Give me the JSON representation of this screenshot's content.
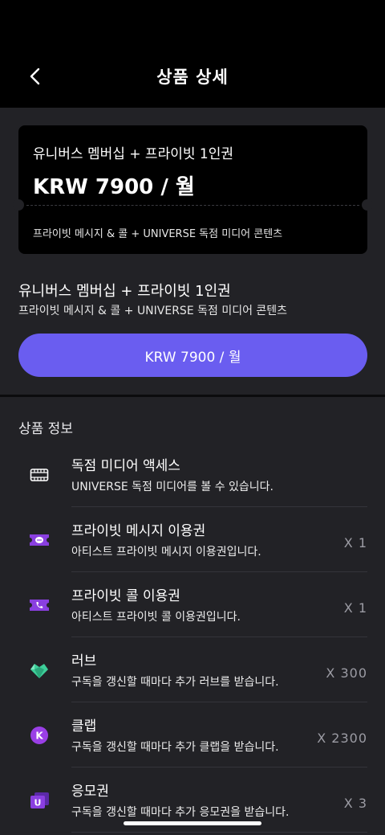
{
  "header": {
    "title": "상품 상세",
    "back_icon": "chevron-left-icon"
  },
  "ticket": {
    "title": "유니버스 멤버십 + 프라이빗 1인권",
    "price": "KRW 7900 / 월",
    "description": "프라이빗 메시지 & 콜 + UNIVERSE 독점 미디어 콘텐츠"
  },
  "plan": {
    "title": "유니버스 멤버십 + 프라이빗 1인권",
    "description": "프라이빗 메시지 & 콜 + UNIVERSE 독점 미디어 콘텐츠",
    "button_label": "KRW 7900 / 월"
  },
  "info": {
    "title": "상품 정보",
    "items": [
      {
        "icon": "film-icon",
        "name": "독점 미디어 액세스",
        "sub": "UNIVERSE 독점 미디어를 볼 수 있습니다.",
        "qty": ""
      },
      {
        "icon": "message-ticket-icon",
        "name": "프라이빗 메시지 이용권",
        "sub": "아티스트 프라이빗 메시지 이용권입니다.",
        "qty": "X 1"
      },
      {
        "icon": "call-ticket-icon",
        "name": "프라이빗 콜 이용권",
        "sub": "아티스트 프라이빗 콜 이용권입니다.",
        "qty": "X 1"
      },
      {
        "icon": "heart-gem-icon",
        "name": "러브",
        "sub": "구독을 갱신할 때마다 추가 러브를 받습니다.",
        "qty": "X 300"
      },
      {
        "icon": "k-coin-icon",
        "name": "클랩",
        "sub": "구독을 갱신할 때마다 추가 클랩을 받습니다.",
        "qty": "X 2300"
      },
      {
        "icon": "u-ticket-icon",
        "name": "응모권",
        "sub": "구독을 갱신할 때마다 추가 응모권을 받습니다.",
        "qty": "X 3"
      }
    ]
  },
  "colors": {
    "accent": "#6a5df0",
    "background": "#222226",
    "header": "#000000",
    "gem": "#3ecf9a"
  }
}
